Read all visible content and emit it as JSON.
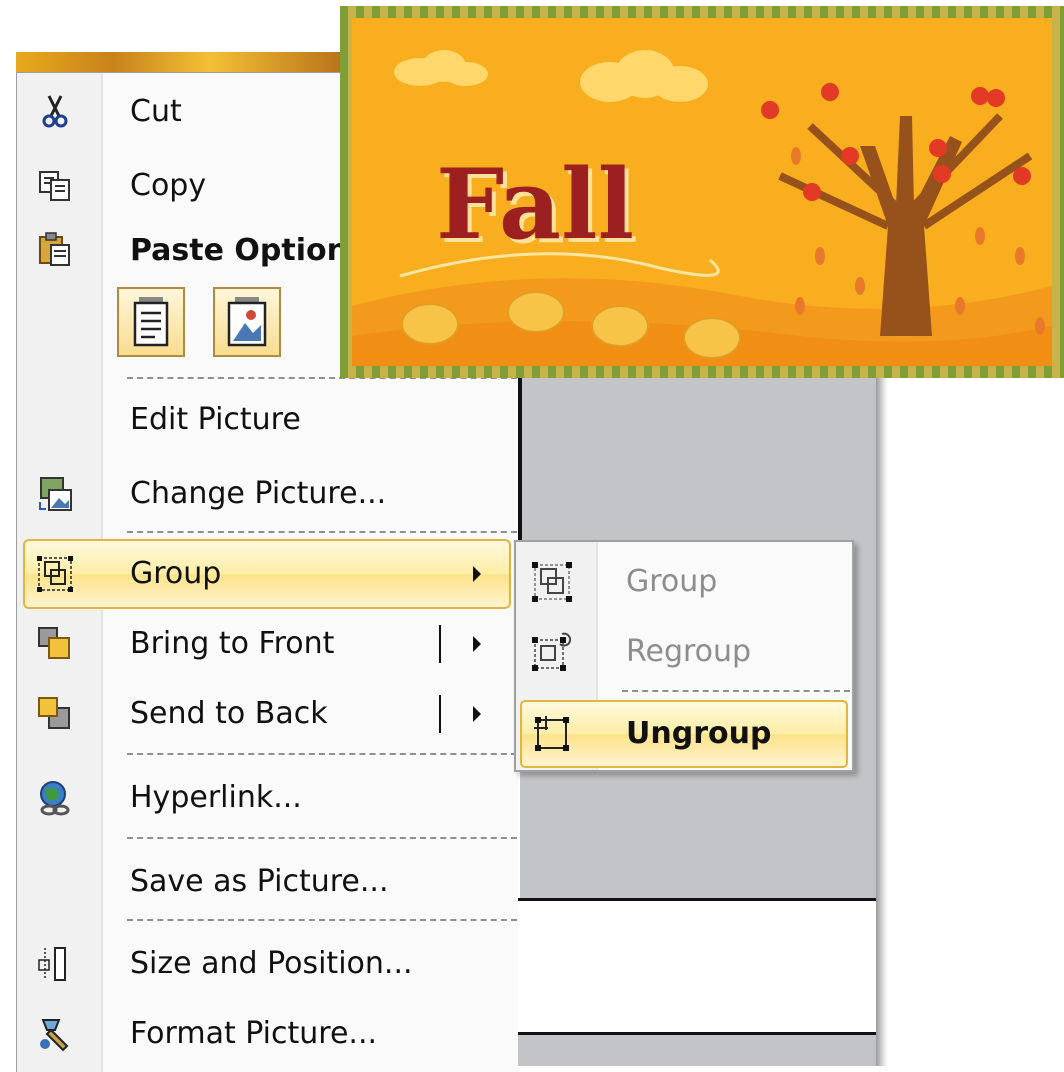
{
  "menu": {
    "cut": "Cut",
    "copy": "Copy",
    "paste_options": "Paste Options:",
    "edit_picture": "Edit Picture",
    "change_picture": "Change Picture...",
    "group": "Group",
    "bring_to_front": "Bring to Front",
    "send_to_back": "Send to Back",
    "hyperlink": "Hyperlink...",
    "save_as_picture": "Save as Picture...",
    "size_and_position": "Size and Position...",
    "format_picture": "Format Picture..."
  },
  "submenu": {
    "group": "Group",
    "regroup": "Regroup",
    "ungroup": "Ungroup"
  },
  "picture": {
    "title": "Fall"
  },
  "colors": {
    "highlight_border": "#e2b53e",
    "highlight_fill": "#fde38a",
    "picture_bg": "#f7a81b",
    "picture_border": "#8da23c",
    "title": "#9c2020"
  }
}
